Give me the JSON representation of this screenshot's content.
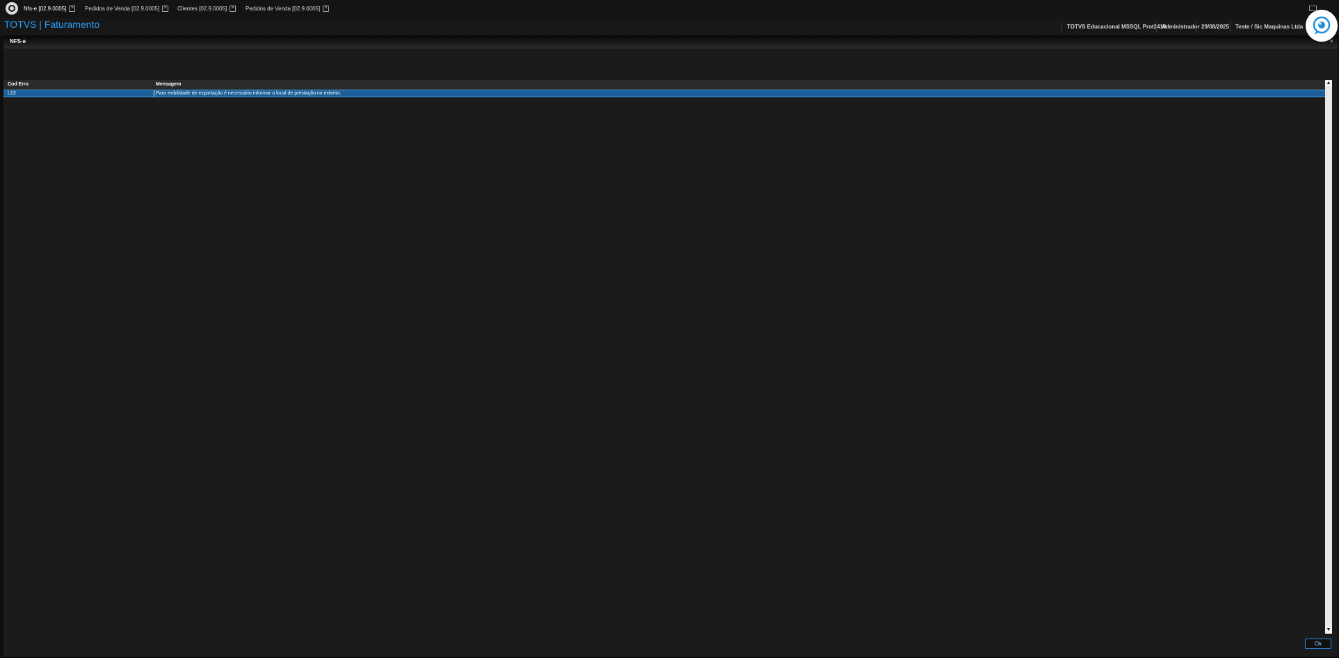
{
  "tabs": [
    {
      "label": "Nfs-e [02.9.0005]",
      "active": true
    },
    {
      "label": "Pedidos de Venda [02.9.0005]",
      "active": false
    },
    {
      "label": "Clientes [02.9.0005]",
      "active": false
    },
    {
      "label": "Pedidos de Venda [02.9.0005]",
      "active": false
    }
  ],
  "header": {
    "title": "TOTVS | Faturamento",
    "environment": "TOTVS Educacional MSSQL Prot2410",
    "user": "Administrador",
    "date": "29/08/2025",
    "company": "Teste / Sic Maquinas Ltda"
  },
  "dialog": {
    "title": "NFS-e",
    "close_glyph": "×"
  },
  "grid": {
    "columns": [
      "Cod Erro",
      "Mensagem"
    ],
    "rows": [
      {
        "code": "L13",
        "message": "Para exibilidade de exportação é necessário informar o local de prestação no exterior."
      }
    ]
  },
  "scroll": {
    "up": "▲",
    "down": "▼"
  },
  "buttons": {
    "ok": "Ok"
  },
  "icons": {
    "logo": "totvs-logo-icon",
    "tab_close": "tab-close-icon",
    "mail": "mail-icon",
    "assistant": "chat-assistant-icon"
  },
  "colors": {
    "accent": "#2aa2ff",
    "selection": "#1a5f99",
    "background": "#1b1b1b"
  }
}
